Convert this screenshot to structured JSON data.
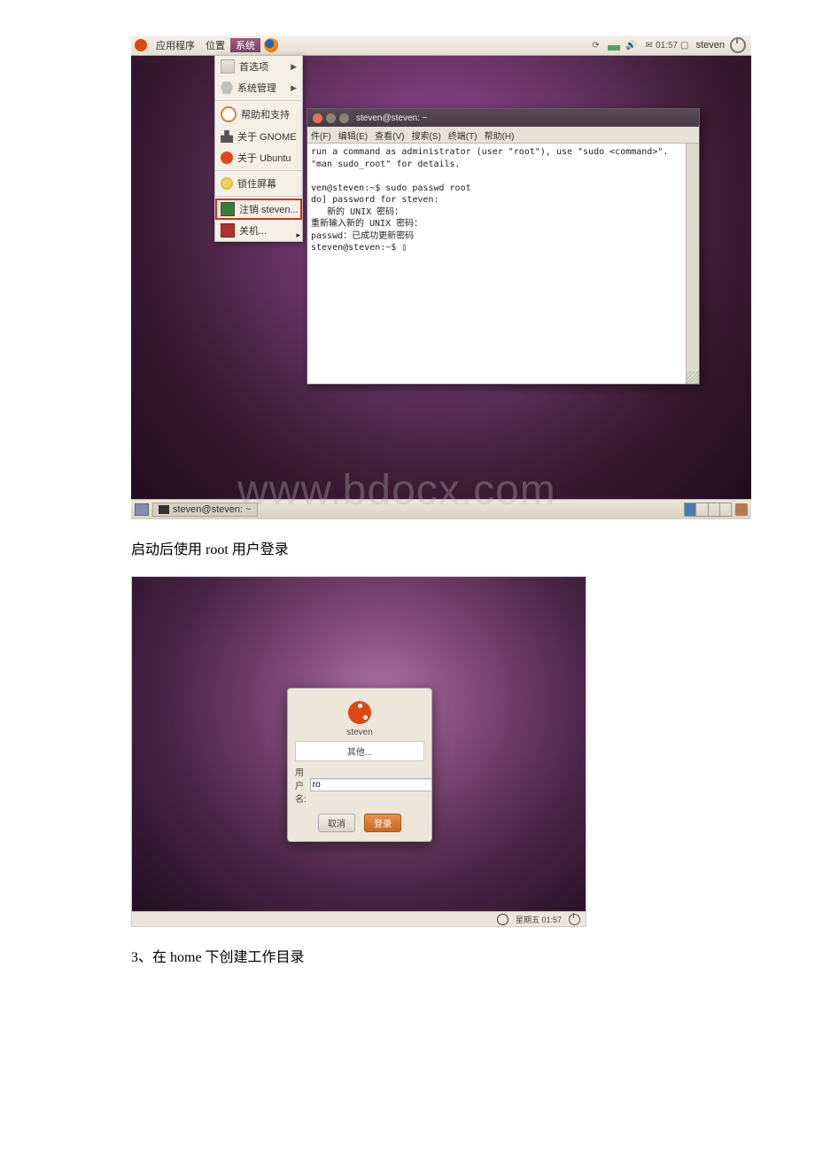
{
  "shot1": {
    "panel": {
      "menu_apps": "应用程序",
      "menu_places": "位置",
      "menu_sys": "系统",
      "clock": "01:57",
      "user": "steven"
    },
    "sysmenu": {
      "pref": "首选项",
      "admin": "系统管理",
      "help": "帮助和支持",
      "gnome": "关于 GNOME",
      "ubuntu": "关于 Ubuntu",
      "lock": "锁住屏幕",
      "logout": "注销 steven...",
      "shutdown": "关机..."
    },
    "terminal": {
      "title": "steven@steven: ~",
      "m_file": "件(F)",
      "m_edit": "编辑(E)",
      "m_view": "查看(V)",
      "m_search": "搜索(S)",
      "m_term": "终端(T)",
      "m_help": "帮助(H)",
      "line1": "run a command as administrator (user \"root\"), use \"sudo <command>\".",
      "line2": "\"man sudo_root\" for details.",
      "line3": "ven@steven:~$ sudo passwd root",
      "line4": "do] password for steven:",
      "line5": "   新的 UNIX 密码：",
      "line6": "重新输入新的 UNIX 密码：",
      "line7": "passwd：已成功更新密码",
      "line8": "steven@steven:~$ "
    },
    "taskbar_task": "steven@steven: ~"
  },
  "caption1": "启动后使用 root 用户登录",
  "shot2": {
    "user_steven": "steven",
    "user_other": "其他...",
    "username_label": "用户名:",
    "username_value": "ro",
    "cancel": "取消",
    "login": "登录",
    "clock": "星期五 01:57"
  },
  "caption2": "3、在 home 下创建工作目录",
  "watermark": "www.bdocx.com"
}
